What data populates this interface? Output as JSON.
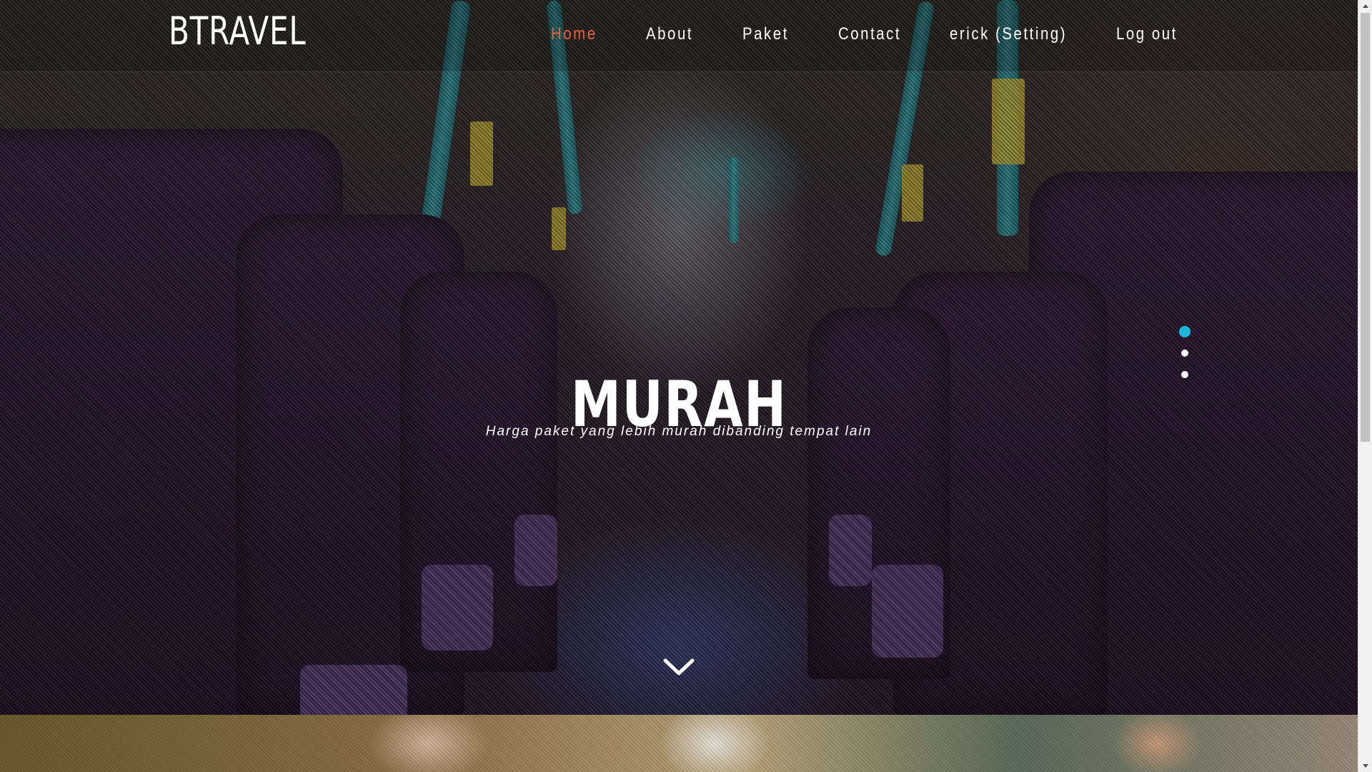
{
  "brand": {
    "name": "BTRAVEL"
  },
  "nav": {
    "items": [
      {
        "label": "Home",
        "active": true
      },
      {
        "label": "About",
        "active": false
      },
      {
        "label": "Paket",
        "active": false
      },
      {
        "label": "Contact",
        "active": false
      },
      {
        "label": "erick (Setting)",
        "active": false
      },
      {
        "label": "Log out",
        "active": false
      }
    ],
    "active_color": "#e8613a"
  },
  "hero": {
    "title": "MURAH",
    "subtitle": "Harga paket yang lebih murah dibanding tempat lain",
    "slide_count": 3,
    "active_slide": 1,
    "active_dot_color": "#19b8d8",
    "scroll_icon": "chevron-down-icon"
  }
}
